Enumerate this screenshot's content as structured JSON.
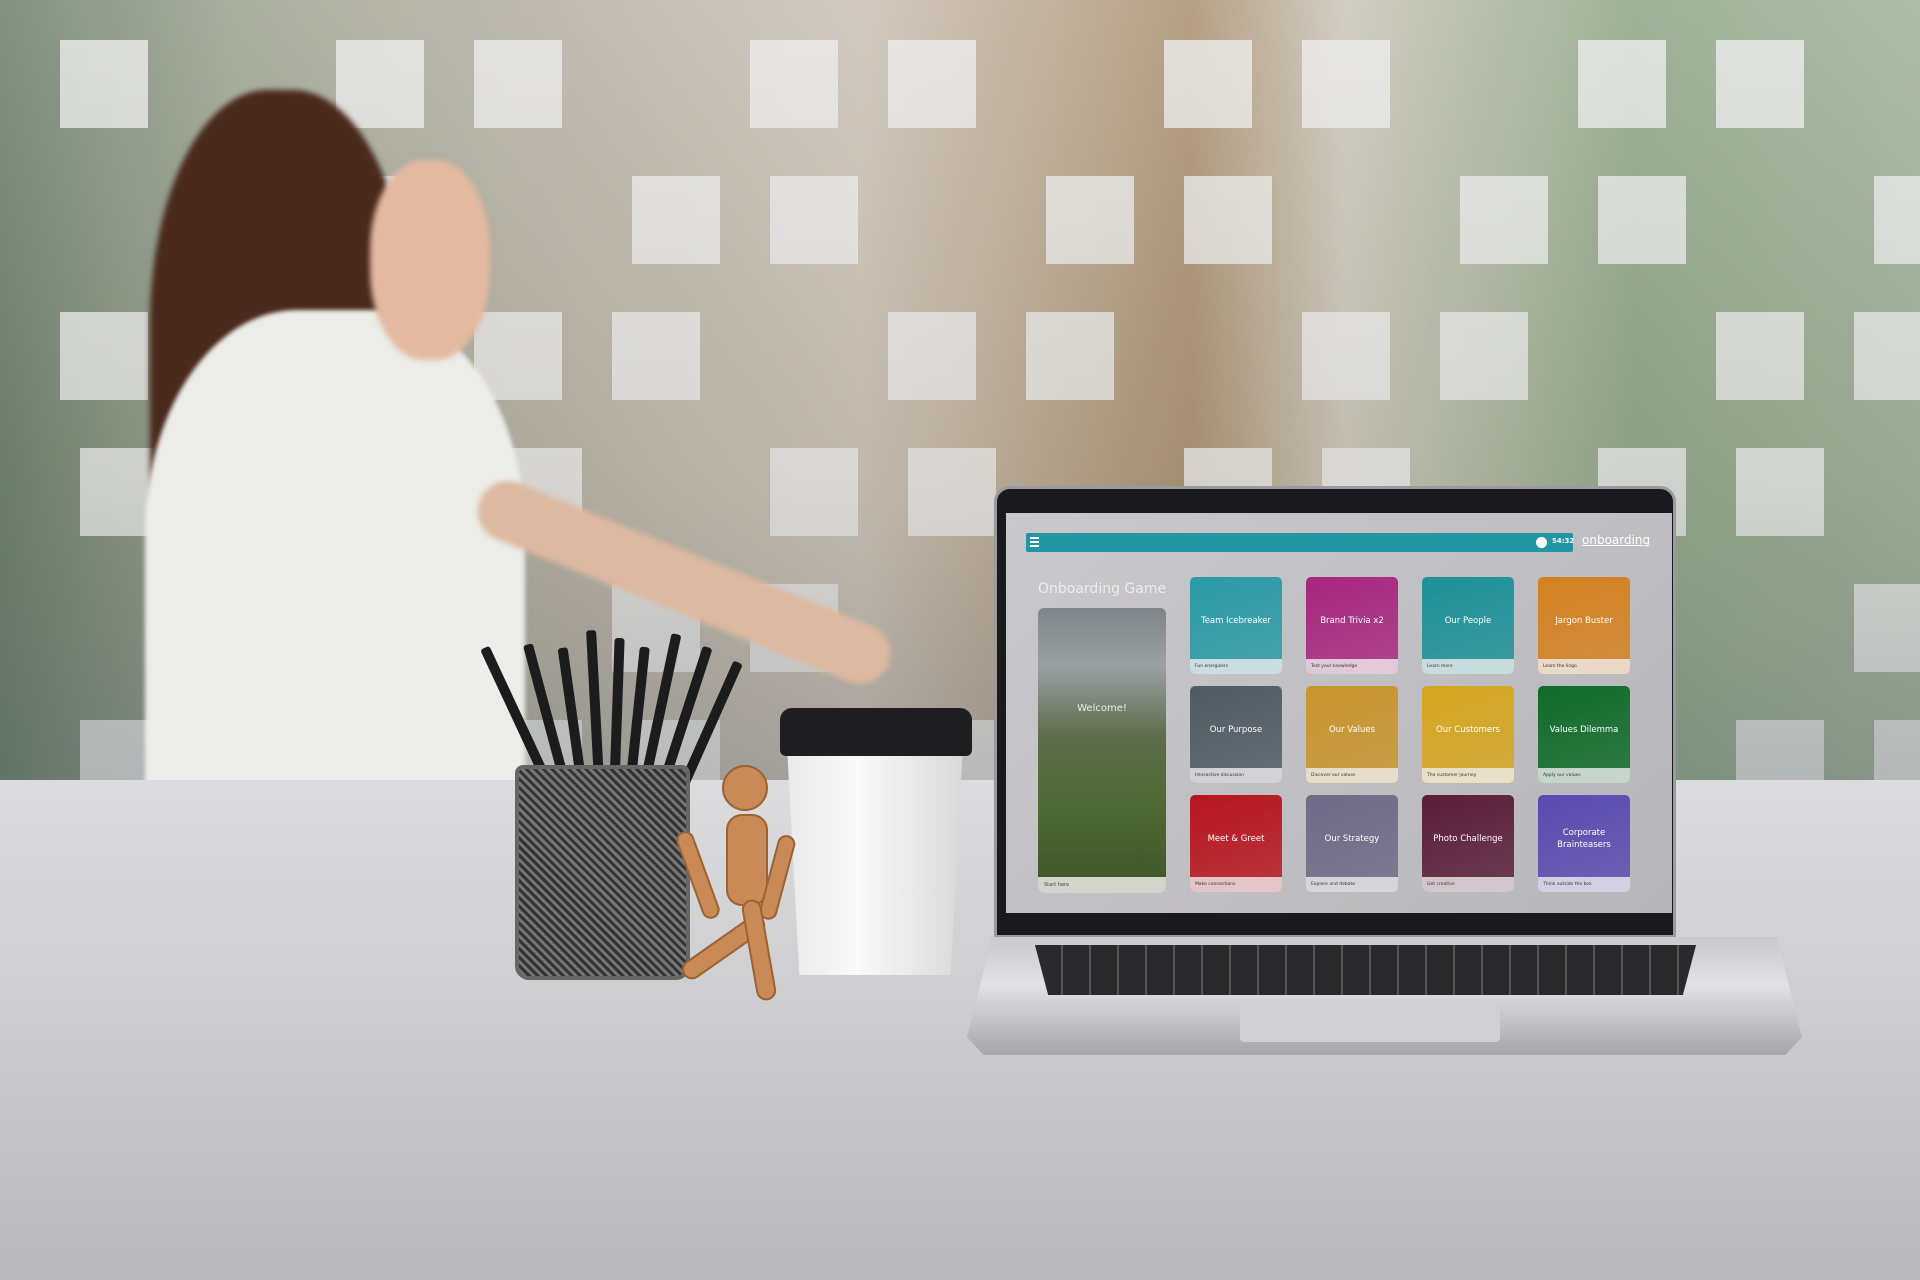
{
  "app": {
    "menu_icon": "hamburger-icon",
    "timer_icon": "clock-icon",
    "timer": "54:32",
    "logo": "onboarding",
    "title": "Onboarding Game",
    "accent_color": "#2296a2"
  },
  "welcome": {
    "title": "Welcome!",
    "caption": "Start here"
  },
  "tiles": [
    {
      "title": "Team Icebreaker",
      "caption": "Fun energizers",
      "color": "#2a9aa6"
    },
    {
      "title": "Brand Trivia x2",
      "caption": "Test your knowledge",
      "color": "#a8267f"
    },
    {
      "title": "Our People",
      "caption": "Learn more",
      "color": "#1d9199"
    },
    {
      "title": "Jargon Buster",
      "caption": "Learn the lingo",
      "color": "#d4811f"
    },
    {
      "title": "Our Purpose",
      "caption": "Interactive discussion",
      "color": "#4f5a62"
    },
    {
      "title": "Our Values",
      "caption": "Discover our values",
      "color": "#c9952c"
    },
    {
      "title": "Our Customers",
      "caption": "The customer journey",
      "color": "#d6a61f"
    },
    {
      "title": "Values Dilemma",
      "caption": "Apply our values",
      "color": "#0f6b2a"
    },
    {
      "title": "Meet & Greet",
      "caption": "Make connections",
      "color": "#b8151e"
    },
    {
      "title": "Our Strategy",
      "caption": "Explore and debate",
      "color": "#6f6a86"
    },
    {
      "title": "Photo Challenge",
      "caption": "Get creative",
      "color": "#5a1d3a"
    },
    {
      "title": "Corporate Brainteasers",
      "caption": "Think outside the box",
      "color": "#5a4bb0"
    }
  ]
}
